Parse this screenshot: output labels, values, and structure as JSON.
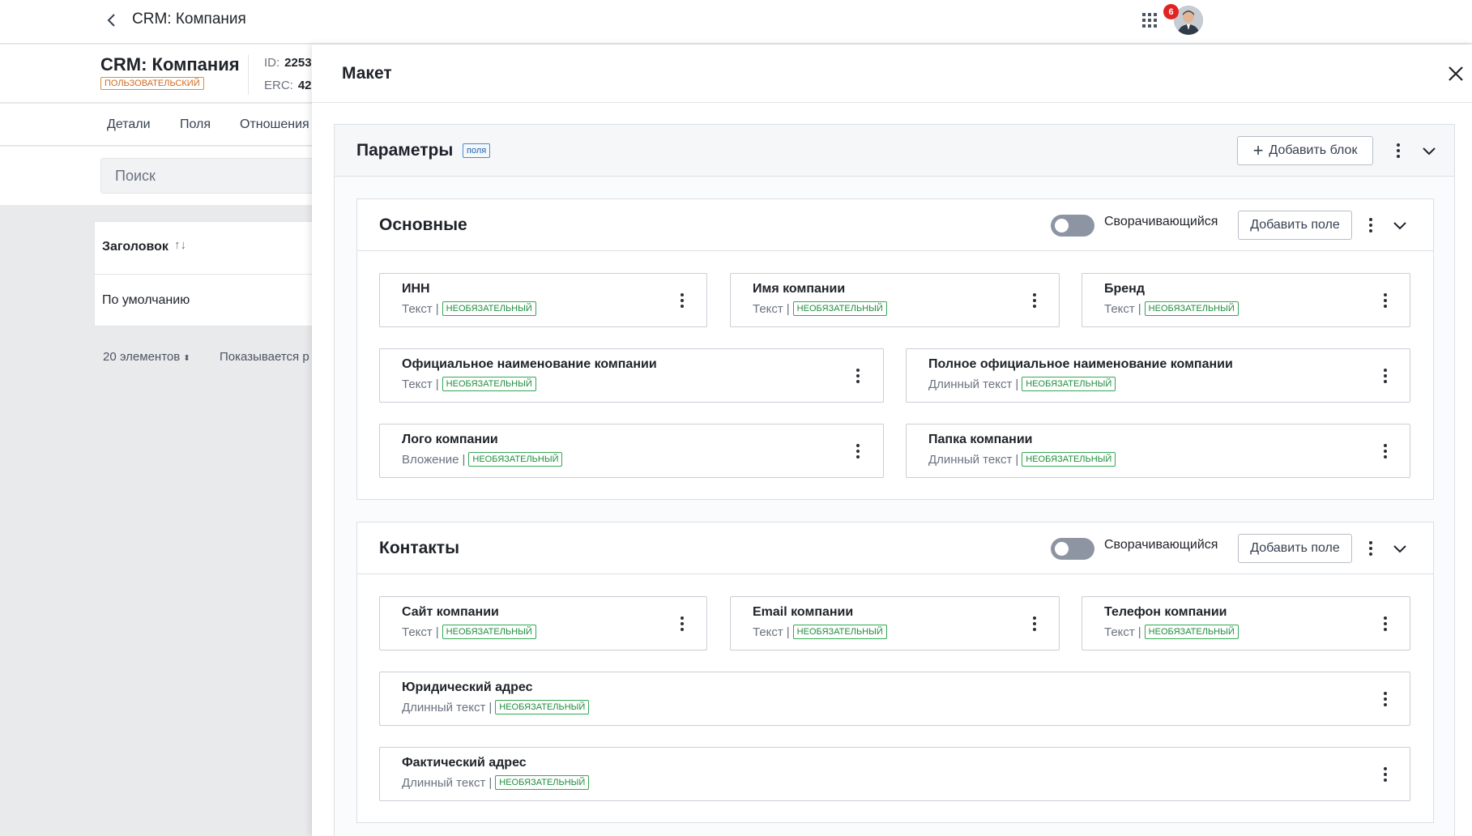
{
  "topbar": {
    "title": "CRM: Компания",
    "notifications_count": "6"
  },
  "entity": {
    "name": "CRM: Компания",
    "type_badge": "ПОЛЬЗОВАТЕЛЬСКИЙ",
    "id_label": "ID:",
    "id_value": "2253",
    "erc_label": "ERC:",
    "erc_value": "42"
  },
  "tabs": [
    "Детали",
    "Поля",
    "Отношения"
  ],
  "search": {
    "placeholder": "Поиск"
  },
  "table": {
    "header": "Заголовок",
    "sort_icon": "↑↓",
    "rows": [
      "По умолчанию"
    ]
  },
  "pagination": {
    "page_size": "20 элементов",
    "showing": "Показывается р"
  },
  "panel": {
    "title": "Макет",
    "section": {
      "title": "Параметры",
      "tag": "поля",
      "add_block_label": "Добавить блок"
    },
    "blocks": [
      {
        "title": "Основные",
        "toggle_label": "Сворачивающийся",
        "add_field_label": "Добавить поле",
        "fields": [
          {
            "name": "ИНН",
            "type": "Текст",
            "required": "НЕОБЯЗАТЕЛЬНЫЙ"
          },
          {
            "name": "Имя компании",
            "type": "Текст",
            "required": "НЕОБЯЗАТЕЛЬНЫЙ"
          },
          {
            "name": "Бренд",
            "type": "Текст",
            "required": "НЕОБЯЗАТЕЛЬНЫЙ"
          },
          {
            "name": "Официальное наименование компании",
            "type": "Текст",
            "required": "НЕОБЯЗАТЕЛЬНЫЙ"
          },
          {
            "name": "Полное официальное наименование компании",
            "type": "Длинный текст",
            "required": "НЕОБЯЗАТЕЛЬНЫЙ"
          },
          {
            "name": "Лого компании",
            "type": "Вложение",
            "required": "НЕОБЯЗАТЕЛЬНЫЙ"
          },
          {
            "name": "Папка компании",
            "type": "Длинный текст",
            "required": "НЕОБЯЗАТЕЛЬНЫЙ"
          }
        ]
      },
      {
        "title": "Контакты",
        "toggle_label": "Сворачивающийся",
        "add_field_label": "Добавить поле",
        "fields": [
          {
            "name": "Сайт компании",
            "type": "Текст",
            "required": "НЕОБЯЗАТЕЛЬНЫЙ"
          },
          {
            "name": "Email компании",
            "type": "Текст",
            "required": "НЕОБЯЗАТЕЛЬНЫЙ"
          },
          {
            "name": "Телефон компании",
            "type": "Текст",
            "required": "НЕОБЯЗАТЕЛЬНЫЙ"
          },
          {
            "name": "Юридический адрес",
            "type": "Длинный текст",
            "required": "НЕОБЯЗАТЕЛЬНЫЙ"
          },
          {
            "name": "Фактический адрес",
            "type": "Длинный текст",
            "required": "НЕОБЯЗАТЕЛЬНЫЙ"
          }
        ]
      }
    ]
  },
  "colors": {
    "accent_blue": "#1c64b4",
    "optional_green": "#1e8e3e",
    "custom_orange": "#d2691e",
    "notification_red": "#e02424"
  }
}
